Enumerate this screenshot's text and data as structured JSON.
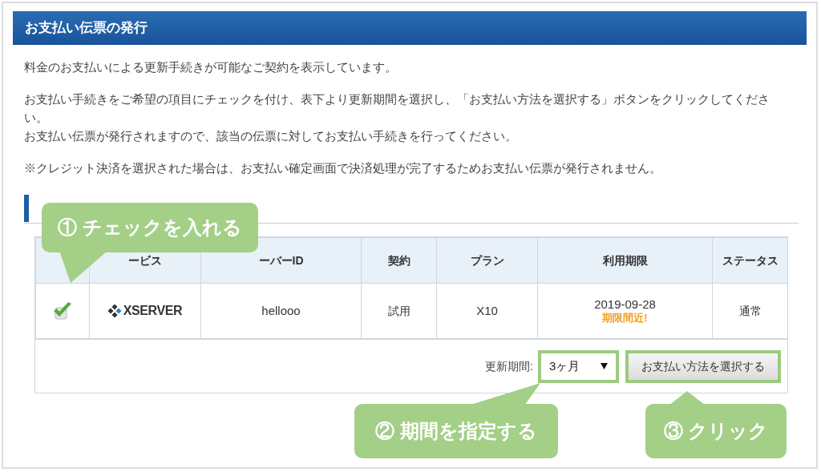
{
  "title": "お支払い伝票の発行",
  "paragraphs": [
    "料金のお支払いによる更新手続きが可能なご契約を表示しています。",
    [
      "お支払い手続きをご希望の項目にチェックを付け、表下より更新期間を選択し、「お支払い方法を選択する」ボタンをクリックしてください。",
      "お支払い伝票が発行されますので、該当の伝票に対してお支払い手続きを行ってください。"
    ],
    "※クレジット決済を選択された場合は、お支払い確定画面で決済処理が完了するためお支払い伝票が発行されません。"
  ],
  "table": {
    "columns": [
      "ービス",
      "ーバーID",
      "契約",
      "プラン",
      "利用期限",
      "ステータス"
    ],
    "rows": [
      {
        "checked": true,
        "service": "XSERVER",
        "server_id": "hellooo",
        "contract": "試用",
        "plan": "X10",
        "expiry": "2019-09-28",
        "expiry_note": "期限間近!",
        "status": "通常"
      }
    ]
  },
  "renewal": {
    "label": "更新期間:",
    "value": "3ヶ月",
    "button": "お支払い方法を選択する"
  },
  "callouts": [
    {
      "text": "① チェックを入れる"
    },
    {
      "text": "② 期間を指定する"
    },
    {
      "text": "③ クリック"
    }
  ]
}
